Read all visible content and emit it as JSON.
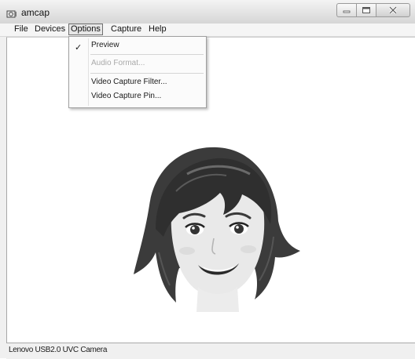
{
  "window": {
    "title": "amcap"
  },
  "menubar": {
    "items": [
      {
        "label": "File"
      },
      {
        "label": "Devices"
      },
      {
        "label": "Options"
      },
      {
        "label": "Capture"
      },
      {
        "label": "Help"
      }
    ]
  },
  "options_menu": {
    "items": [
      {
        "label": "Preview",
        "checked": true,
        "enabled": true,
        "check_glyph": "✓"
      },
      {
        "label": "Audio Format...",
        "enabled": false
      },
      {
        "label": "Video Capture Filter...",
        "enabled": true
      },
      {
        "label": "Video Capture Pin...",
        "enabled": true
      }
    ]
  },
  "preview": {
    "image": "cartoon-face-illustration"
  },
  "statusbar": {
    "text": "Lenovo USB2.0 UVC Camera"
  }
}
